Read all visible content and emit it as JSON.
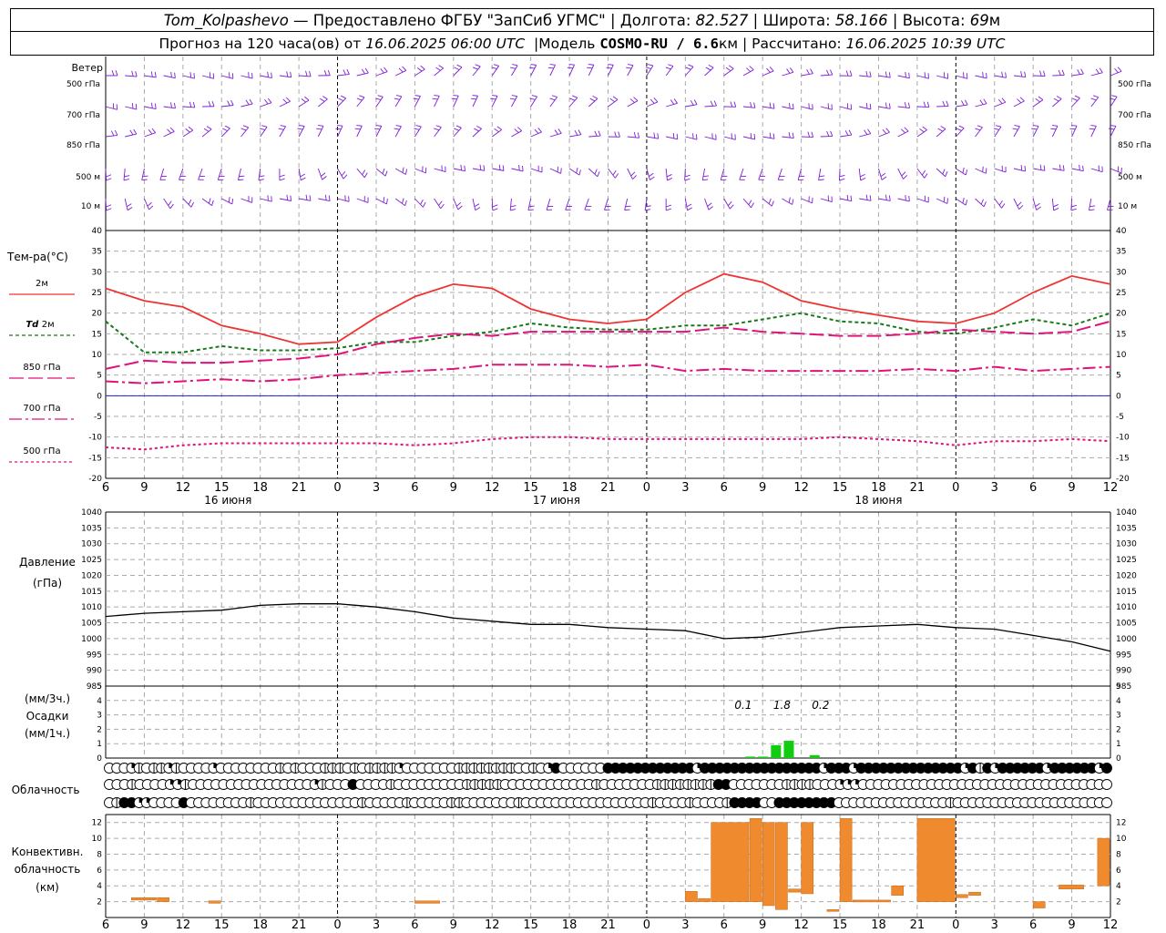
{
  "header": {
    "station": "Tom_Kolpashevo",
    "dash": "—",
    "provider": "Предоставлено ФГБУ \"ЗапСиб УГМС\"",
    "lon_label": "Долгота:",
    "lon": "82.527",
    "lat_label": "Широта:",
    "lat": "58.166",
    "alt_label": "Высота:",
    "alt": "69",
    "alt_unit": "м",
    "sep": "|",
    "forecast_label": "Прогноз на 120 часа(ов) от",
    "forecast_time": "16.06.2025 06:00 UTC",
    "model_label": "Модель",
    "model": "COSMO-RU / 6.6",
    "model_unit": "км",
    "calc_label": "Рассчитано:",
    "calc_time": "16.06.2025 10:39 UTC"
  },
  "time_axis": {
    "hours": [
      "6",
      "9",
      "12",
      "15",
      "18",
      "21",
      "0",
      "3",
      "6",
      "9",
      "12",
      "15",
      "18",
      "21",
      "0",
      "3",
      "6",
      "9",
      "12",
      "15",
      "18",
      "21",
      "0",
      "3",
      "6",
      "9",
      "12"
    ],
    "days": [
      "16 июня",
      "17 июня",
      "18 июня"
    ]
  },
  "wind_panel": {
    "title": "Ветер",
    "levels": [
      "500 гПа",
      "700 гПа",
      "850 гПа",
      "500 м",
      "10 м"
    ],
    "color": "#7b1fd6"
  },
  "temp_panel": {
    "title": "Тем-ра(°C)",
    "legend": [
      {
        "label": "2м",
        "italic_prefix": ""
      },
      {
        "label": "2м",
        "italic_prefix": "Td"
      },
      {
        "label": "850 гПа",
        "italic_prefix": ""
      },
      {
        "label": "700 гПа",
        "italic_prefix": ""
      },
      {
        "label": "500 гПа",
        "italic_prefix": ""
      }
    ],
    "ticks": [
      "40",
      "35",
      "30",
      "25",
      "20",
      "15",
      "10",
      "5",
      "0",
      "-5",
      "-10",
      "-15",
      "-20"
    ]
  },
  "pressure_panel": {
    "title1": "Давление",
    "title2": "(гПа)",
    "ticks": [
      "1040",
      "1035",
      "1030",
      "1025",
      "1020",
      "1015",
      "1010",
      "1005",
      "1000",
      "995",
      "990",
      "985"
    ]
  },
  "precip_panel": {
    "title1": "(мм/3ч.)",
    "title2": "Осадки",
    "title3": "(мм/1ч.)",
    "ticks": [
      "5",
      "4",
      "3",
      "2",
      "1",
      "0"
    ],
    "labels": [
      "0.1",
      "1.8",
      "0.2"
    ]
  },
  "cloud_panel": {
    "title": "Облачность"
  },
  "conv_panel": {
    "title1": "Конвективн.",
    "title2": "облачность",
    "title3": "(км)",
    "ticks": [
      "12",
      "10",
      "8",
      "6",
      "4",
      "2"
    ]
  },
  "colors": {
    "t2m": "#ee3333",
    "td2m": "#1a7a1a",
    "t850": "#e0137a",
    "t700": "#e0137a",
    "t500": "#e0137a",
    "zero_line": "#2222cc",
    "precip": "#11cc11",
    "conv": "#ef8a2e"
  },
  "chart_data": [
    {
      "type": "line",
      "title": "Тем-ра(°C)",
      "x": [
        6,
        9,
        12,
        15,
        18,
        21,
        24,
        27,
        30,
        33,
        36,
        39,
        42,
        45,
        48,
        51,
        54,
        57,
        60,
        63,
        66,
        69,
        72,
        75,
        78,
        81,
        84
      ],
      "ylim": [
        -20,
        40
      ],
      "series": [
        {
          "name": "2м",
          "values": [
            26,
            23,
            21.5,
            17,
            15,
            12.5,
            13,
            19,
            24,
            27,
            26,
            21,
            18.5,
            17.5,
            18.5,
            25,
            29.5,
            27.5,
            23,
            21,
            19.5,
            18,
            17.5,
            20,
            25,
            29,
            27
          ]
        },
        {
          "name": "Td 2м",
          "values": [
            18,
            10.5,
            10.5,
            12,
            11,
            11,
            11.5,
            13,
            13,
            14.5,
            15.5,
            17.5,
            16.5,
            16,
            16,
            17,
            17,
            18.5,
            20,
            18,
            17.5,
            15.5,
            15,
            16.5,
            18.5,
            17,
            20
          ]
        },
        {
          "name": "850 гПа",
          "values": [
            6.5,
            8.5,
            8,
            8,
            8.5,
            9,
            10,
            12.5,
            14,
            15,
            14.5,
            15.5,
            15.5,
            15.5,
            15.5,
            15.5,
            16.5,
            15.5,
            15,
            14.5,
            14.5,
            15,
            16,
            15.5,
            15,
            15.5,
            18
          ]
        },
        {
          "name": "700 гПа",
          "values": [
            3.5,
            3,
            3.5,
            4,
            3.5,
            4,
            5,
            5.5,
            6,
            6.5,
            7.5,
            7.5,
            7.5,
            7,
            7.5,
            6,
            6.5,
            6,
            6,
            6,
            6,
            6.5,
            6,
            7,
            6,
            6.5,
            7
          ]
        },
        {
          "name": "500 гПа",
          "values": [
            -12.5,
            -13,
            -12,
            -11.5,
            -11.5,
            -11.5,
            -11.5,
            -11.5,
            -12,
            -11.5,
            -10.5,
            -10,
            -10,
            -10.5,
            -10.5,
            -10.5,
            -10.5,
            -10.5,
            -10.5,
            -10,
            -10.5,
            -11,
            -12,
            -11,
            -11,
            -10.5,
            -11
          ]
        }
      ]
    },
    {
      "type": "line",
      "title": "Давление",
      "x": [
        6,
        9,
        12,
        15,
        18,
        21,
        24,
        27,
        30,
        33,
        36,
        39,
        42,
        45,
        48,
        51,
        54,
        57,
        60,
        63,
        66,
        69,
        72,
        75,
        78,
        81,
        84
      ],
      "ylim": [
        985,
        1040
      ],
      "series": [
        {
          "name": "Давление",
          "values": [
            1007,
            1008,
            1008.5,
            1009,
            1010.5,
            1011,
            1011,
            1010,
            1008.5,
            1006.5,
            1005.5,
            1004.5,
            1004.5,
            1003.5,
            1003,
            1002.5,
            1000,
            1000.5,
            1002,
            1003.5,
            1004,
            1004.5,
            1003.5,
            1003,
            1001,
            999,
            996
          ]
        }
      ]
    },
    {
      "type": "bar",
      "title": "Осадки",
      "x": [
        56,
        57,
        58,
        59,
        60,
        61
      ],
      "values": [
        0.1,
        0.1,
        0.9,
        1.2,
        0,
        0.2
      ],
      "ylim": [
        0,
        5
      ]
    },
    {
      "type": "bar",
      "title": "Конвективн. облачность",
      "ylim": [
        0,
        13
      ],
      "segments": [
        {
          "x": [
            8,
            10
          ],
          "bottom": 2.2,
          "top": 2.5
        },
        {
          "x": [
            10,
            11
          ],
          "bottom": 2.0,
          "top": 2.5
        },
        {
          "x": [
            14,
            15
          ],
          "bottom": 1.8,
          "top": 2.1
        },
        {
          "x": [
            30,
            32
          ],
          "bottom": 1.8,
          "top": 2.1
        },
        {
          "x": [
            51,
            52
          ],
          "bottom": 2.0,
          "top": 3.3
        },
        {
          "x": [
            52,
            53
          ],
          "bottom": 2.0,
          "top": 2.4
        },
        {
          "x": [
            53,
            56
          ],
          "bottom": 2.0,
          "top": 12.0
        },
        {
          "x": [
            56,
            57
          ],
          "bottom": 2.0,
          "top": 12.5
        },
        {
          "x": [
            57,
            58
          ],
          "bottom": 1.5,
          "top": 12.0
        },
        {
          "x": [
            58,
            59
          ],
          "bottom": 1.0,
          "top": 12.0
        },
        {
          "x": [
            59,
            60
          ],
          "bottom": 3.2,
          "top": 3.6
        },
        {
          "x": [
            60,
            61
          ],
          "bottom": 3.0,
          "top": 12.0
        },
        {
          "x": [
            62,
            63
          ],
          "bottom": 0.8,
          "top": 1.0
        },
        {
          "x": [
            63,
            64
          ],
          "bottom": 2.0,
          "top": 12.5
        },
        {
          "x": [
            64,
            67
          ],
          "bottom": 2.0,
          "top": 2.2
        },
        {
          "x": [
            67,
            68
          ],
          "bottom": 2.8,
          "top": 4.0
        },
        {
          "x": [
            69,
            72
          ],
          "bottom": 2.0,
          "top": 12.5
        },
        {
          "x": [
            72,
            73
          ],
          "bottom": 2.5,
          "top": 2.9
        },
        {
          "x": [
            73,
            74
          ],
          "bottom": 2.8,
          "top": 3.2
        },
        {
          "x": [
            78,
            79
          ],
          "bottom": 1.2,
          "top": 2.0
        },
        {
          "x": [
            80,
            82
          ],
          "bottom": 3.6,
          "top": 4.1
        },
        {
          "x": [
            83,
            84
          ],
          "bottom": 4.0,
          "top": 10.0
        }
      ]
    },
    {
      "type": "table",
      "title": "Облачность",
      "x_start": 6,
      "x_step": 1,
      "rows": [
        "000320223200003000000002020002220202222300000002222222200203400000044444444444434444444444444444344434444444444444434243444444344444434",
        "000200003320000000000000000320004000020000000002222200000000000020000000222222224400000002222000333000000000000000000000000000000000",
        "024433000040000000020000000000000020000020000022000000020000000000000000020000200002444400444444440000000000000002000000000000000000000"
      ]
    }
  ]
}
